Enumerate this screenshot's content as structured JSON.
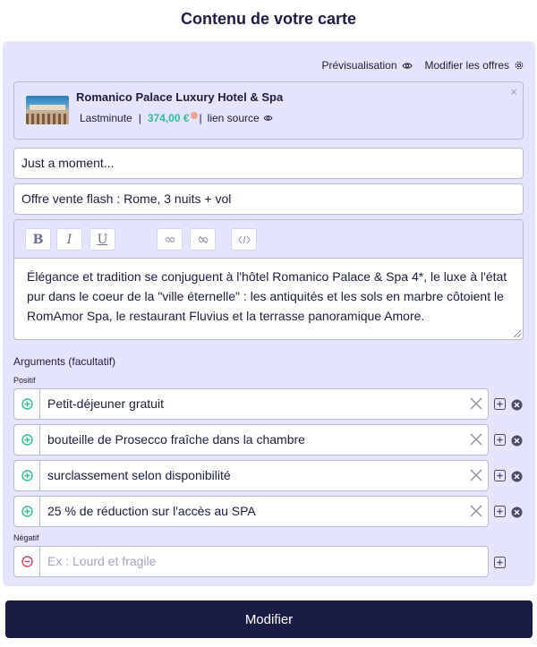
{
  "page": {
    "title": "Contenu de votre carte"
  },
  "actions": {
    "preview_label": "Prévisualisation",
    "edit_offers_label": "Modifier les offres"
  },
  "offer": {
    "name": "Romanico Palace Luxury Hotel & Spa",
    "provider": "Lastminute",
    "separator": "|",
    "price": "374,00 €",
    "source_label": "lien source",
    "close_glyph": "×"
  },
  "fields": {
    "title_value": "Just a moment...",
    "subtitle_value": "Offre vente flash : Rome, 3 nuits + vol"
  },
  "editor": {
    "toolbar": {
      "bold": "B",
      "italic": "I",
      "underline": "U"
    },
    "content": "Élégance et tradition se conjuguent à l'hôtel Romanico Palace & Spa 4*, le luxe à l'état pur dans le coeur de la \"ville éternelle\" : les antiquités et les sols en marbre côtoient le RomAmor Spa, le restaurant Fluvius et la terrasse panoramique Amore."
  },
  "arguments": {
    "label": "Arguments (facultatif)",
    "positive_label": "Positif",
    "negative_label": "Négatif",
    "positive": [
      "Petit-déjeuner gratuit",
      "bouteille de Prosecco fraîche dans la chambre",
      "surclassement selon disponibilité",
      "25 % de réduction sur l'accès au SPA"
    ],
    "negative_placeholder": "Ex : Lourd et fragile"
  },
  "submit_label": "Modifier",
  "colors": {
    "accent": "#1b1c46",
    "panel": "#e4e5fd",
    "positive": "#2ebd8f",
    "negative": "#d6455d"
  }
}
